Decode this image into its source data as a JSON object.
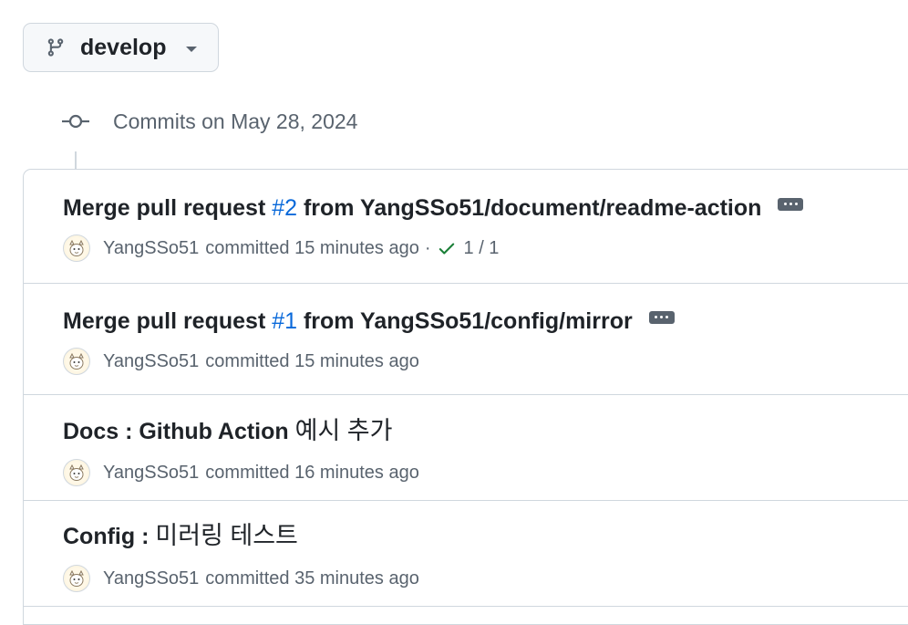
{
  "branch": {
    "name": "develop",
    "icon": "git-branch-icon"
  },
  "timeline": {
    "heading": "Commits on May 28, 2024",
    "icon": "git-commit-icon"
  },
  "commits": [
    {
      "title_prefix": "Merge pull request ",
      "pr_number": "#2",
      "title_suffix": " from YangSSo51/document/readme-action",
      "author": "YangSSo51",
      "committed_text": "committed 15 minutes ago",
      "status_sep": "·",
      "status_icon": "check-icon",
      "status_color": "#1a7f37",
      "status_count": "1 / 1"
    },
    {
      "title_prefix": "Merge pull request ",
      "pr_number": "#1",
      "title_suffix": " from YangSSo51/config/mirror",
      "author": "YangSSo51",
      "committed_text": "committed 15 minutes ago"
    },
    {
      "title_latin": "Docs : Github Action ",
      "title_korean": "예시 추가",
      "author": "YangSSo51",
      "committed_text": "committed 16 minutes ago"
    },
    {
      "title_latin": "Config : ",
      "title_korean": "미러링 테스트",
      "author": "YangSSo51",
      "committed_text": "committed 35 minutes ago"
    }
  ],
  "colors": {
    "link": "#0969da",
    "muted": "#59636e",
    "border": "#d0d7de",
    "text": "#1f2328"
  }
}
